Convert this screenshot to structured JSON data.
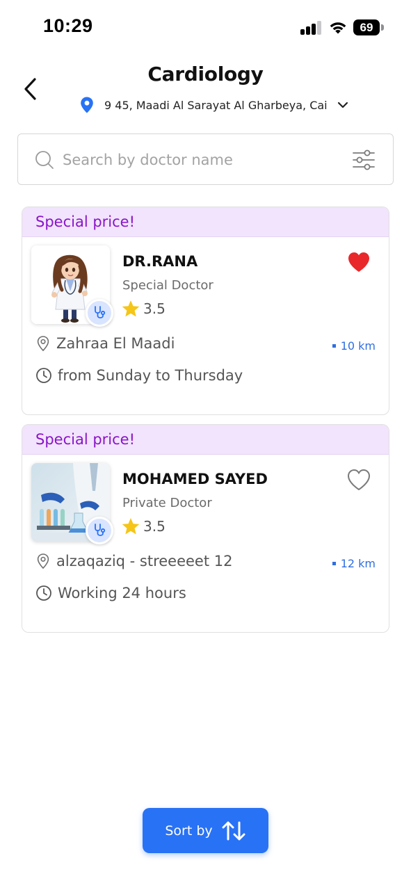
{
  "status_bar": {
    "time": "10:29",
    "battery": "69",
    "icons": [
      "cellular-signal-icon",
      "wifi-icon",
      "battery-icon"
    ]
  },
  "header": {
    "title": "Cardiology",
    "location": "9 45, Maadi Al Sarayat Al Gharbeya, Cai",
    "icons": [
      "back-arrow-icon",
      "location-pin-icon",
      "chevron-down-icon"
    ]
  },
  "search": {
    "placeholder": "Search by doctor name",
    "icons": [
      "search-icon",
      "filter-sliders-icon"
    ]
  },
  "doctors": [
    {
      "banner": "Special price!",
      "name": "DR.RANA",
      "type": "Special Doctor",
      "rating": "3.5",
      "address": "Zahraa El Maadi",
      "distance": "10 km",
      "hours": "from Sunday to Thursday",
      "favorite": true,
      "photo": "cartoon-female-doctor-avatar"
    },
    {
      "banner": "Special price!",
      "name": "MOHAMED SAYED",
      "type": "Private Doctor",
      "rating": "3.5",
      "address": "alzaqaziq - streeeeet 12",
      "distance": "12 km",
      "hours": "Working 24 hours",
      "favorite": false,
      "photo": "laboratory-photo"
    }
  ],
  "sort": {
    "label": "Sort by",
    "icon": "sort-arrows-icon"
  },
  "colors": {
    "accent": "#2872f5",
    "promo_text": "#8b14c8",
    "promo_bg": "#f1e4fc",
    "favorite": "#e8282b",
    "star": "#f5c518",
    "distance": "#2f6fe0"
  }
}
